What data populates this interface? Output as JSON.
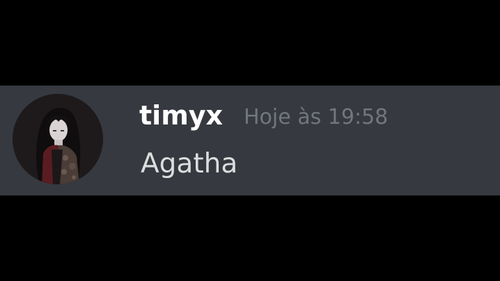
{
  "message": {
    "author": "timyx",
    "timestamp": "Hoje às 19:58",
    "content": "Agatha",
    "avatar_icon": "user-avatar-anime-portrait"
  },
  "colors": {
    "page_background": "#000000",
    "message_background": "#36393f",
    "author_color": "#ffffff",
    "timestamp_color": "#72767d",
    "content_color": "#dcddde"
  }
}
